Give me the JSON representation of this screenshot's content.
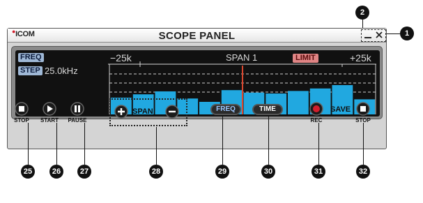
{
  "window": {
    "logo": "ICOM",
    "title": "SCOPE PANEL"
  },
  "scope": {
    "freq_badge": "FREQ",
    "step_badge": "STEP",
    "step_value": "25.0kHz",
    "left_edge": "−25k",
    "right_edge": "+25k",
    "span_label": "SPAN 1",
    "limit_badge": "LIMIT",
    "spectrum_levels": [
      0.4,
      0.48,
      0.55,
      0.38,
      0.3,
      0.58,
      0.52,
      0.5,
      0.56,
      0.62,
      0.7,
      0.36
    ]
  },
  "controls": {
    "stop_label": "STOP",
    "start_label": "START",
    "pause_label": "PAUSE",
    "span_label": "SPAN",
    "freq_label": "FREQ",
    "time_label": "TIME",
    "rec_label": "REC",
    "save_label": "SAVE",
    "save_stop_label": "STOP"
  },
  "callouts": {
    "c1": "1",
    "c2": "2",
    "c25": "25",
    "c26": "26",
    "c27": "27",
    "c28": "28",
    "c29": "29",
    "c30": "30",
    "c31": "31",
    "c32": "32"
  },
  "colors": {
    "spectrum": "#21a8e0",
    "marker": "#d9472f",
    "rec": "#d21e2c"
  }
}
